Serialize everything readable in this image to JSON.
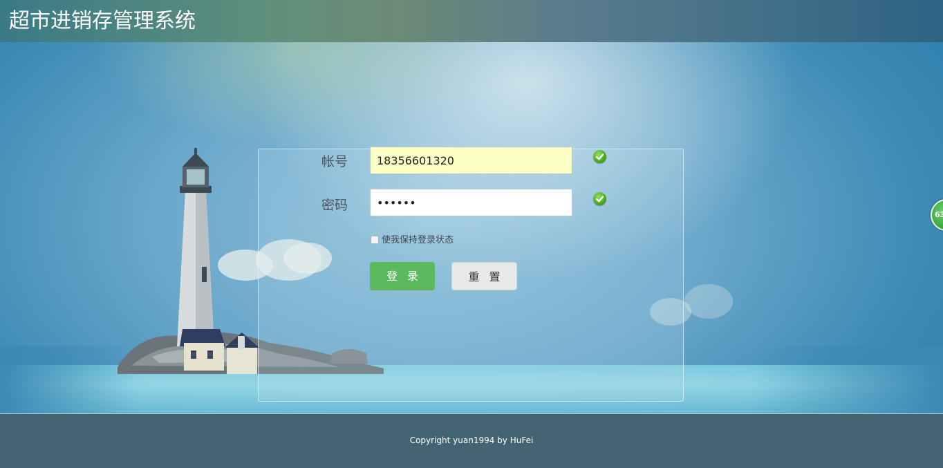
{
  "header": {
    "title": "超市进销存管理系统"
  },
  "login": {
    "account_label": "帐号",
    "account_value": "18356601320",
    "password_label": "密码",
    "password_value": "••••••",
    "remember_label": "使我保持登录状态",
    "login_button": "登录",
    "reset_button": "重置"
  },
  "side_badge": {
    "text": "63"
  },
  "footer": {
    "copyright": "Copyright yuan1994 by HuFei"
  },
  "icons": {
    "account_status": "check-circle-icon",
    "password_status": "check-circle-icon"
  },
  "colors": {
    "header_bg": "#2e6384",
    "login_button": "#5cb85c",
    "reset_button": "#e8e8e8",
    "account_field_bg": "#fbffc6",
    "footer_bg": "#446474",
    "valid_icon": "#3ea013"
  }
}
